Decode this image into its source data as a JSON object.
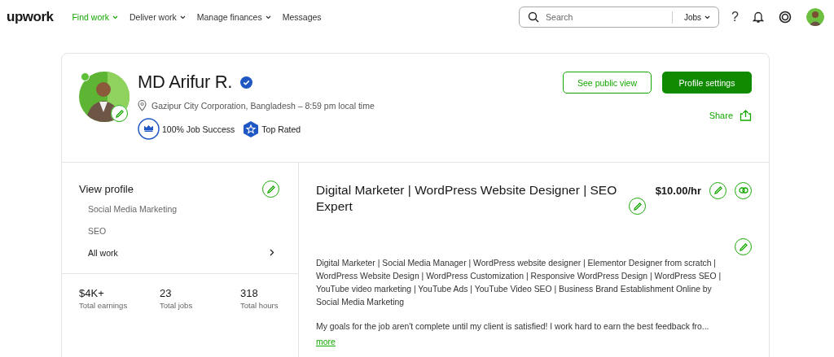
{
  "header": {
    "logo": "upwork",
    "nav": [
      {
        "label": "Find work",
        "selected": true,
        "dropdown": true
      },
      {
        "label": "Deliver work",
        "selected": false,
        "dropdown": true
      },
      {
        "label": "Manage finances",
        "selected": false,
        "dropdown": true
      },
      {
        "label": "Messages",
        "selected": false,
        "dropdown": false
      }
    ],
    "search": {
      "placeholder": "Search",
      "scope": "Jobs"
    },
    "help": "?"
  },
  "profile": {
    "name": "MD Arifur R.",
    "online": true,
    "verified": true,
    "location": "Gazipur City Corporation, Bangladesh – 8:59 pm local time",
    "badges": [
      {
        "kind": "job-success",
        "label": "100% Job Success"
      },
      {
        "kind": "top-rated",
        "label": "Top Rated"
      }
    ],
    "buttons": [
      {
        "label": "See public view",
        "kind": "outline"
      },
      {
        "label": "Profile settings",
        "kind": "primary"
      }
    ],
    "share": "Share"
  },
  "sidebar": {
    "title": "View profile",
    "items": [
      {
        "label": "Social Media Marketing",
        "selected": false
      },
      {
        "label": "SEO",
        "selected": false
      },
      {
        "label": "All work",
        "selected": true
      }
    ],
    "stats": [
      {
        "value": "$4K+",
        "label": "Total earnings"
      },
      {
        "value": "23",
        "label": "Total jobs"
      },
      {
        "value": "318",
        "label": "Total hours"
      }
    ]
  },
  "main": {
    "title": "Digital Marketer | WordPress Website Designer | SEO Expert",
    "rate": "$10.00/hr",
    "paragraphs": [
      "Digital Marketer | Social Media Manager | WordPress website designer | Elementor Designer from scratch | WordPress Website Design | WordPress Customization | Responsive WordPress Design | WordPress SEO | YouTube video marketing | YouTube Ads | YouTube Video SEO | Business Brand Establishment Online by Social Media Marketing",
      "My goals for the job aren't complete until my client is satisfied! I work hard to earn the best feedback fro..."
    ],
    "more": "more"
  }
}
